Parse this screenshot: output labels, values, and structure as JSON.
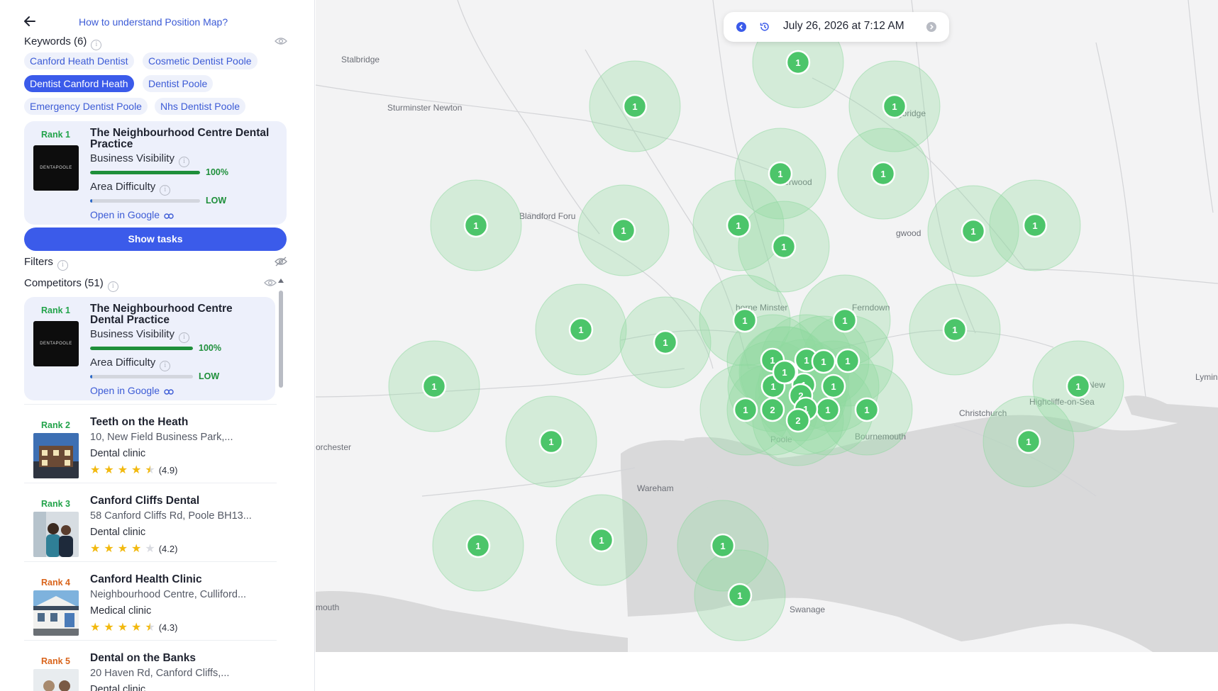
{
  "header": {
    "back_icon": "arrow-left-icon",
    "help_link": "How to understand Position Map?"
  },
  "keywords": {
    "title": "Keywords (6)",
    "chips": [
      {
        "label": "Canford Heath Dentist",
        "active": false
      },
      {
        "label": "Cosmetic Dentist Poole",
        "active": false
      },
      {
        "label": "Dentist Canford Heath",
        "active": true
      },
      {
        "label": "Dentist Poole",
        "active": false
      },
      {
        "label": "Emergency Dentist Poole",
        "active": false
      },
      {
        "label": "Nhs Dentist Poole",
        "active": false
      }
    ]
  },
  "business_card": {
    "rank": "Rank 1",
    "name": "The Neighbourhood Centre Dental Practice",
    "logo_text": "DENTAPOOLE",
    "visibility_label": "Business Visibility",
    "visibility_value": "100%",
    "visibility_fraction": 1.0,
    "difficulty_label": "Area Difficulty",
    "difficulty_value": "LOW",
    "difficulty_fraction": 0.02,
    "open_google": "Open in Google"
  },
  "show_tasks_label": "Show tasks",
  "filters_title": "Filters",
  "competitors": {
    "title": "Competitors (51)",
    "top": {
      "rank": "Rank 1",
      "name": "The Neighbourhood Centre Dental Practice",
      "logo_text": "DENTAPOOLE",
      "visibility_label": "Business Visibility",
      "visibility_value": "100%",
      "visibility_fraction": 1.0,
      "difficulty_label": "Area Difficulty",
      "difficulty_value": "LOW",
      "difficulty_fraction": 0.02,
      "open_google": "Open in Google"
    },
    "list": [
      {
        "rank": "Rank 2",
        "name": "Teeth on the Heath",
        "address": "10, New Field Business Park,...",
        "type": "Dental clinic",
        "rating": 4.9,
        "rating_text": "(4.9)",
        "rank_color": "#22a34a"
      },
      {
        "rank": "Rank 3",
        "name": "Canford Cliffs Dental",
        "address": "58 Canford Cliffs Rd, Poole BH13...",
        "type": "Dental clinic",
        "rating": 4.2,
        "rating_text": "(4.2)",
        "rank_color": "#22a34a"
      },
      {
        "rank": "Rank 4",
        "name": "Canford Health Clinic",
        "address": "Neighbourhood Centre, Culliford...",
        "type": "Medical clinic",
        "rating": 4.3,
        "rating_text": "(4.3)",
        "rank_color": "#d9641b"
      },
      {
        "rank": "Rank 5",
        "name": "Dental on the Banks",
        "address": "20 Haven Rd, Canford Cliffs,...",
        "type": "Dental clinic",
        "rating": 0,
        "rating_text": "",
        "rank_color": "#d9641b"
      }
    ]
  },
  "map": {
    "date_label": "July 26, 2026 at 7:12 AM",
    "pin_color": "#4cc56a",
    "halo_color": "#8fd9a0",
    "places": [
      "Stalbridge",
      "Sturminster Newton",
      "Blandford Foru",
      "Verwood",
      "gbridge",
      "gwood",
      "horne Minster",
      "Ferndown",
      "New",
      "Highcliffe-on-Sea",
      "Lymin",
      "Christchurch",
      "Bournemouth",
      "Poole",
      "orchester",
      "Wareham",
      "Swanage",
      "mouth"
    ],
    "grid_points": [
      {
        "rank": 1
      },
      {
        "rank": 1
      },
      {
        "rank": 1
      },
      {
        "rank": 1
      },
      {
        "rank": 1
      },
      {
        "rank": 1
      },
      {
        "rank": 1
      },
      {
        "rank": 1
      },
      {
        "rank": 1
      },
      {
        "rank": 1
      },
      {
        "rank": 1
      },
      {
        "rank": 1
      },
      {
        "rank": 1
      },
      {
        "rank": 1
      },
      {
        "rank": 1
      },
      {
        "rank": 1
      },
      {
        "rank": 1
      },
      {
        "rank": 1
      },
      {
        "rank": 1
      },
      {
        "rank": 1
      },
      {
        "rank": 1
      },
      {
        "rank": 1
      },
      {
        "rank": 1
      },
      {
        "rank": 1
      },
      {
        "rank": 1
      },
      {
        "rank": 1
      },
      {
        "rank": 1
      },
      {
        "rank": 1
      },
      {
        "rank": 1
      },
      {
        "rank": 1
      },
      {
        "rank": 1
      },
      {
        "rank": 1
      },
      {
        "rank": 1
      },
      {
        "rank": 1
      },
      {
        "rank": 2
      },
      {
        "rank": 2
      },
      {
        "rank": 1
      },
      {
        "rank": 2
      },
      {
        "rank": 1
      },
      {
        "rank": 1
      }
    ]
  }
}
